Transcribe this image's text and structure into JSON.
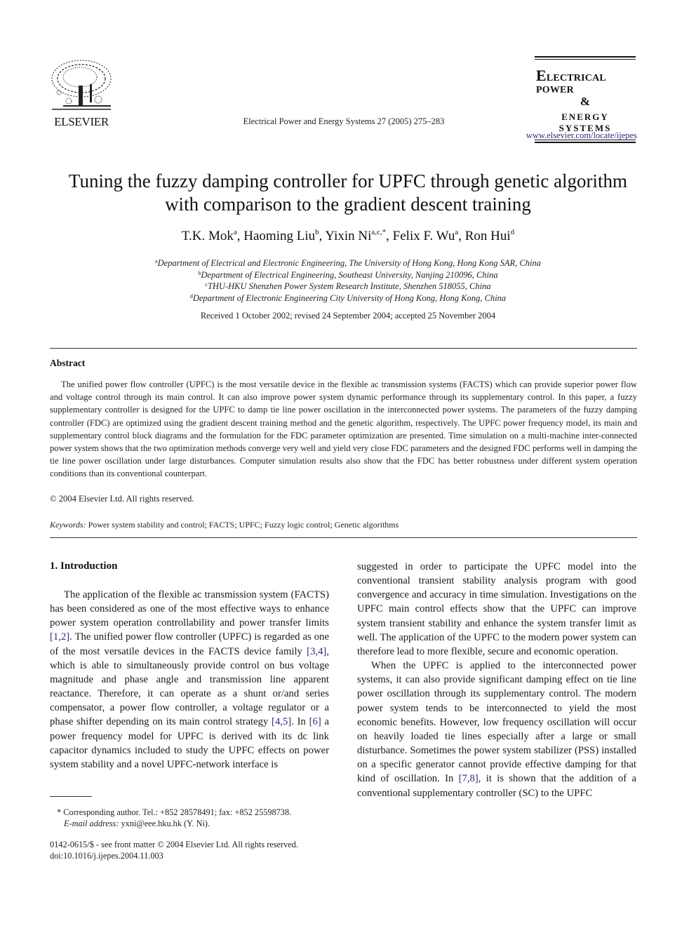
{
  "header": {
    "publisher_logo_text": "ELSEVIER",
    "journal_ref": "Electrical Power and Energy Systems 27 (2005) 275–283",
    "brand": {
      "line1_initial": "E",
      "line1_rest": "LECTRICAL POWER",
      "line2": "&",
      "line3": "ENERGY SYSTEMS"
    },
    "url": "www.elsevier.com/locate/ijepes"
  },
  "title": {
    "line1": "Tuning the fuzzy damping controller for UPFC through genetic algorithm",
    "line2": "with comparison to the gradient descent training"
  },
  "authors": [
    {
      "name": "T.K. Mok",
      "sup": "a",
      "sep": ", "
    },
    {
      "name": "Haoming Liu",
      "sup": "b",
      "sep": ", "
    },
    {
      "name": "Yixin Ni",
      "sup": "a,c,*",
      "sep": ", "
    },
    {
      "name": "Felix F. Wu",
      "sup": "a",
      "sep": ", "
    },
    {
      "name": "Ron Hui",
      "sup": "d",
      "sep": ""
    }
  ],
  "affiliations": [
    {
      "mark": "a",
      "text": "Department of Electrical and Electronic Engineering, The University of Hong Kong, Hong Kong SAR, China"
    },
    {
      "mark": "b",
      "text": "Department of Electrical Engineering, Southeast University, Nanjing 210096, China"
    },
    {
      "mark": "c",
      "text": "THU-HKU Shenzhen Power System Research Institute, Shenzhen 518055, China"
    },
    {
      "mark": "d",
      "text": "Department of Electronic Engineering City University of Hong Kong, Hong Kong, China"
    }
  ],
  "received": "Received 1 October 2002; revised 24 September 2004; accepted 25 November 2004",
  "abstract": {
    "heading": "Abstract",
    "body": "The unified power flow controller (UPFC) is the most versatile device in the flexible ac transmission systems (FACTS) which can provide superior power flow and voltage control through its main control. It can also improve power system dynamic performance through its supplementary control. In this paper, a fuzzy supplementary controller is designed for the UPFC to damp tie line power oscillation in the interconnected power systems. The parameters of the fuzzy damping controller (FDC) are optimized using the gradient descent training method and the genetic algorithm, respectively. The UPFC power frequency model, its main and supplementary control block diagrams and the formulation for the FDC parameter optimization are presented. Time simulation on a multi-machine inter-connected power system shows that the two optimization methods converge very well and yield very close FDC parameters and the designed FDC performs well in damping the tie line power oscillation under large disturbances. Computer simulation results also show that the FDC has better robustness under different system operation conditions than its conventional counterpart.",
    "copyright": "© 2004 Elsevier Ltd. All rights reserved."
  },
  "keywords": {
    "label": "Keywords:",
    "text": "Power system stability and control; FACTS; UPFC; Fuzzy logic control; Genetic algorithms"
  },
  "intro": {
    "heading": "1. Introduction",
    "left_para": [
      {
        "t": "The application of the flexible ac transmission system (FACTS) has been considered as one of the most effective ways to enhance power system operation controllability and power transfer limits "
      },
      {
        "ref": "[1,2]"
      },
      {
        "t": ". The unified power flow controller (UPFC) is regarded as one of the most versatile devices in the FACTS device family "
      },
      {
        "ref": "[3,4]"
      },
      {
        "t": ", which is able to simultaneously provide control on bus voltage magnitude and phase angle and transmission line apparent reactance. Therefore, it can operate as a shunt or/and series compensator, a power flow controller, a voltage regulator or a phase shifter depending on its main control strategy "
      },
      {
        "ref": "[4,5]"
      },
      {
        "t": ". In "
      },
      {
        "ref": "[6]"
      },
      {
        "t": " a power frequency model for UPFC is derived with its dc link capacitor dynamics included to study the UPFC effects on power system stability and a novel UPFC-network interface is"
      }
    ],
    "right_para1": "suggested in order to participate the UPFC model into the conventional transient stability analysis program with good convergence and accuracy in time simulation. Investigations on the UPFC main control effects show that the UPFC can improve system transient stability and enhance the system transfer limit as well. The application of the UPFC to the modern power system can therefore lead to more flexible, secure and economic operation.",
    "right_para2": [
      {
        "t": "When the UPFC is applied to the interconnected power systems, it can also provide significant damping effect on tie line power oscillation through its supplementary control. The modern power system tends to be interconnected to yield the most economic benefits. However, low frequency oscillation will occur on heavily loaded tie lines especially after a large or small disturbance. Sometimes the power system stabilizer (PSS) installed on a specific generator cannot provide effective damping for that kind of oscillation. In "
      },
      {
        "ref": "[7,8]"
      },
      {
        "t": ", it is shown that the addition of a conventional supplementary controller (SC) to the UPFC"
      }
    ]
  },
  "footnote": {
    "line1": "* Corresponding author. Tel.: +852 28578491; fax: +852 25598738.",
    "email_label": "E-mail address:",
    "email_rest": " yxni@eee.hku.hk (Y. Ni)."
  },
  "issn": {
    "line1": "0142-0615/$ - see front matter © 2004 Elsevier Ltd. All rights reserved.",
    "line2": "doi:10.1016/j.ijepes.2004.11.003"
  },
  "colors": {
    "text": "#1a1a1a",
    "link": "#2b2b80"
  }
}
